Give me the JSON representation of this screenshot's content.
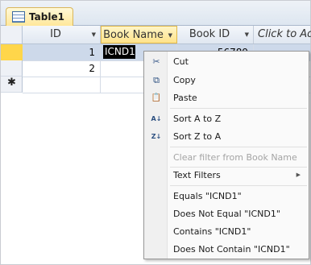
{
  "tab": {
    "label": "Table1"
  },
  "columns": [
    {
      "label": "ID",
      "arrow": "▼"
    },
    {
      "label": "Book Name",
      "arrow": "▼"
    },
    {
      "label": "Book ID",
      "arrow": "▼"
    },
    {
      "label": "Click to Ad",
      "arrow": ""
    }
  ],
  "rows": [
    {
      "id": "1",
      "book_name": "ICND1",
      "book_id": "56789"
    },
    {
      "id": "2",
      "book_name": "",
      "book_id": ""
    }
  ],
  "new_row_marker": "✱",
  "menu": {
    "items": [
      {
        "key": "cut",
        "label": "Cut",
        "icon": "scissors-icon",
        "glyph": "✂"
      },
      {
        "key": "copy",
        "label": "Copy",
        "icon": "copy-icon",
        "glyph": "⧉"
      },
      {
        "key": "paste",
        "label": "Paste",
        "icon": "paste-icon",
        "glyph": "📋"
      },
      {
        "key": "sort-asc",
        "label": "Sort A to Z",
        "icon": "sort-a-to-z-icon",
        "glyph": "A↓"
      },
      {
        "key": "sort-desc",
        "label": "Sort Z to A",
        "icon": "sort-z-to-a-icon",
        "glyph": "Z↓"
      },
      {
        "key": "clear-filter",
        "label": "Clear filter from Book Name",
        "disabled": true
      },
      {
        "key": "text-filters",
        "label": "Text Filters",
        "submenu_arrow": "▶"
      },
      {
        "key": "equals",
        "label": "Equals \"ICND1\""
      },
      {
        "key": "not-equal",
        "label": "Does Not Equal \"ICND1\""
      },
      {
        "key": "contains",
        "label": "Contains \"ICND1\""
      },
      {
        "key": "not-contain",
        "label": "Does Not Contain \"ICND1\""
      }
    ]
  }
}
